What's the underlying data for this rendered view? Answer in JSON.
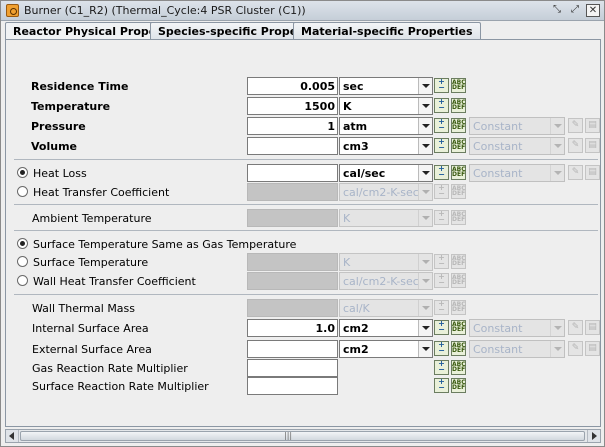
{
  "window": {
    "title": "Burner (C1_R2)  (Thermal_Cycle:4 PSR Cluster (C1))"
  },
  "tabs": [
    {
      "label": "Reactor Physical Properties",
      "active": true
    },
    {
      "label": "Species-specific Properties",
      "active": false
    },
    {
      "label": "Material-specific Properties",
      "active": false
    }
  ],
  "rows": {
    "residence_time": {
      "label": "Residence Time",
      "value": "0.005",
      "unit": "sec"
    },
    "temperature": {
      "label": "Temperature",
      "value": "1500",
      "unit": "K"
    },
    "pressure": {
      "label": "Pressure",
      "value": "1",
      "unit": "atm",
      "profile": "Constant"
    },
    "volume": {
      "label": "Volume",
      "value": "",
      "unit": "cm3",
      "profile": "Constant"
    },
    "heat_loss": {
      "label": "Heat Loss",
      "value": "",
      "unit": "cal/sec",
      "profile": "Constant",
      "selected": true
    },
    "heat_transfer_coeff": {
      "label": "Heat Transfer Coefficient",
      "value": "",
      "unit": "cal/cm2-K-sec",
      "selected": false
    },
    "ambient_temperature": {
      "label": "Ambient Temperature",
      "value": "",
      "unit": "K"
    },
    "surface_temp_same": {
      "label": "Surface Temperature Same as Gas Temperature",
      "selected": true
    },
    "surface_temperature": {
      "label": "Surface Temperature",
      "value": "",
      "unit": "K",
      "selected": false
    },
    "wall_heat_transfer": {
      "label": "Wall Heat Transfer Coefficient",
      "value": "",
      "unit": "cal/cm2-K-sec",
      "selected": false
    },
    "wall_thermal_mass": {
      "label": "Wall Thermal Mass",
      "value": "",
      "unit": "cal/K"
    },
    "internal_surface_area": {
      "label": "Internal Surface Area",
      "value": "1.0",
      "unit": "cm2",
      "profile": "Constant"
    },
    "external_surface_area": {
      "label": "External Surface Area",
      "value": "",
      "unit": "cm2",
      "profile": "Constant"
    },
    "gas_reaction_multiplier": {
      "label": "Gas Reaction Rate Multiplier",
      "value": ""
    },
    "surface_reaction_multiplier": {
      "label": "Surface Reaction Rate Multiplier",
      "value": ""
    }
  },
  "icons": {
    "param_button": "+−",
    "catalog_button": "ABC"
  },
  "colors": {
    "titlebar": "#c5ced8",
    "disabled_text": "#a8b4c8",
    "disabled_field": "#c4c4c4"
  }
}
